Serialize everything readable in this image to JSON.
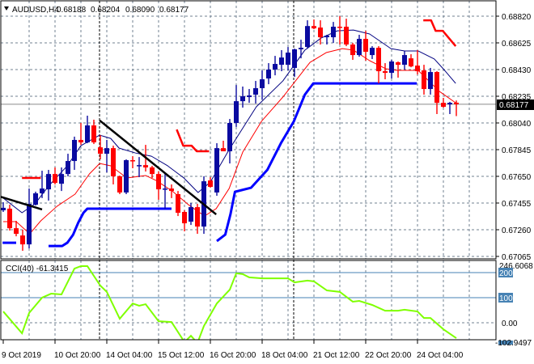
{
  "header": {
    "symbol": "AUDUSD,H4",
    "open": "0.68188",
    "high": "0.68204",
    "low": "0.68090",
    "close": "0.68177",
    "menu_icon": "triangle-down-icon"
  },
  "colors": {
    "bull": "#0a0aa0",
    "bear": "#ff0000",
    "ma_fast": "#000080",
    "ma_slow": "#ff0000",
    "support_step": "#0000ff",
    "resistance_step": "#ff0000",
    "trendline": "#000000",
    "cci_line": "#7fff00",
    "cci_level": "#4682b4",
    "grid": "#708090"
  },
  "price_axis": {
    "labels": [
      "0.68820",
      "0.68625",
      "0.68430",
      "0.68235",
      "0.68040",
      "0.67845",
      "0.67650",
      "0.67455",
      "0.67260",
      "0.67065"
    ],
    "current_price": "0.68177"
  },
  "time_axis": {
    "labels": [
      "9 Oct 2019",
      "10 Oct 20:00",
      "14 Oct 04:00",
      "15 Oct 12:00",
      "16 Oct 20:00",
      "18 Oct 04:00",
      "21 Oct 12:00",
      "22 Oct 20:00",
      "24 Oct 04:00"
    ],
    "bars_per_label": 8
  },
  "cci_panel": {
    "title": "CCI(40) -61.3415",
    "max_label": "246.6068",
    "min_label": "-102.9497",
    "level_labels": [
      "200",
      "100"
    ],
    "zero_label": "0.00"
  },
  "chart_data": [
    {
      "type": "candlestick",
      "title": "AUDUSD,H4",
      "ylim": [
        0.67065,
        0.6882
      ],
      "ohlc": [
        [
          0.67402,
          0.67461,
          0.6739,
          0.6742
        ],
        [
          0.67414,
          0.67443,
          0.67254,
          0.67271
        ],
        [
          0.67271,
          0.67325,
          0.67212,
          0.6723
        ],
        [
          0.67218,
          0.6726,
          0.67106,
          0.67153
        ],
        [
          0.67153,
          0.67561,
          0.67124,
          0.67449
        ],
        [
          0.67443,
          0.67538,
          0.67437,
          0.67526
        ],
        [
          0.67526,
          0.67691,
          0.67491,
          0.67561
        ],
        [
          0.67555,
          0.67697,
          0.67473,
          0.67667
        ],
        [
          0.67667,
          0.67715,
          0.67591,
          0.67602
        ],
        [
          0.67596,
          0.67715,
          0.67543,
          0.67667
        ],
        [
          0.67667,
          0.67815,
          0.6765,
          0.67762
        ],
        [
          0.67762,
          0.6794,
          0.67697,
          0.67916
        ],
        [
          0.67916,
          0.6804,
          0.6788,
          0.67898
        ],
        [
          0.67898,
          0.68093,
          0.67892,
          0.68022
        ],
        [
          0.68022,
          0.68064,
          0.67886,
          0.67898
        ],
        [
          0.67862,
          0.67951,
          0.67774,
          0.67815
        ],
        [
          0.67815,
          0.67916,
          0.67679,
          0.67856
        ],
        [
          0.67856,
          0.67874,
          0.67591,
          0.6765
        ],
        [
          0.6765,
          0.67656,
          0.6752,
          0.67532
        ],
        [
          0.67532,
          0.67774,
          0.6752,
          0.67768
        ],
        [
          0.67768,
          0.67797,
          0.67709,
          0.67762
        ],
        [
          0.67727,
          0.67791,
          0.67644,
          0.67732
        ],
        [
          0.67732,
          0.6788,
          0.67685,
          0.67715
        ],
        [
          0.67715,
          0.67727,
          0.67638,
          0.67667
        ],
        [
          0.67667,
          0.67685,
          0.67479,
          0.67555
        ],
        [
          0.67555,
          0.67667,
          0.67414,
          0.67561
        ],
        [
          0.67561,
          0.67591,
          0.67491,
          0.67543
        ],
        [
          0.6752,
          0.67543,
          0.6736,
          0.67384
        ],
        [
          0.6739,
          0.67402,
          0.67248,
          0.67307
        ],
        [
          0.67319,
          0.67455,
          0.67295,
          0.67425
        ],
        [
          0.67425,
          0.67449,
          0.6723,
          0.67283
        ],
        [
          0.67283,
          0.6765,
          0.6723,
          0.67614
        ],
        [
          0.6762,
          0.67644,
          0.67567,
          0.67573
        ],
        [
          0.67532,
          0.67892,
          0.67508,
          0.67856
        ],
        [
          0.67856,
          0.6791,
          0.67833,
          0.67833
        ],
        [
          0.67833,
          0.68069,
          0.67744,
          0.6804
        ],
        [
          0.6804,
          0.68317,
          0.68011,
          0.68199
        ],
        [
          0.68199,
          0.68306,
          0.68152,
          0.68235
        ],
        [
          0.68229,
          0.68288,
          0.68187,
          0.68241
        ],
        [
          0.68247,
          0.68347,
          0.68182,
          0.68294
        ],
        [
          0.68294,
          0.68424,
          0.68211,
          0.68359
        ],
        [
          0.68365,
          0.68477,
          0.68323,
          0.6843
        ],
        [
          0.6843,
          0.6853,
          0.68388,
          0.68471
        ],
        [
          0.68465,
          0.68572,
          0.68418,
          0.68518
        ],
        [
          0.68465,
          0.68595,
          0.68424,
          0.68554
        ],
        [
          0.68442,
          0.68583,
          0.68377,
          0.68578
        ],
        [
          0.68578,
          0.68648,
          0.68512,
          0.68589
        ],
        [
          0.68595,
          0.6879,
          0.68583,
          0.68748
        ],
        [
          0.68748,
          0.68796,
          0.68725,
          0.68731
        ],
        [
          0.68737,
          0.6879,
          0.68613,
          0.68666
        ],
        [
          0.68666,
          0.68684,
          0.68613,
          0.68678
        ],
        [
          0.68666,
          0.68778,
          0.68625,
          0.68743
        ],
        [
          0.68743,
          0.6882,
          0.68613,
          0.68737
        ],
        [
          0.68743,
          0.68802,
          0.68601,
          0.68613
        ],
        [
          0.68613,
          0.68625,
          0.68501,
          0.68536
        ],
        [
          0.68536,
          0.68684,
          0.68524,
          0.68654
        ],
        [
          0.68654,
          0.68713,
          0.68495,
          0.6856
        ],
        [
          0.68536,
          0.68601,
          0.68507,
          0.68589
        ],
        [
          0.68589,
          0.68601,
          0.68329,
          0.68418
        ],
        [
          0.68418,
          0.68477,
          0.68359,
          0.68406
        ],
        [
          0.68406,
          0.68501,
          0.68365,
          0.68489
        ],
        [
          0.68483,
          0.68489,
          0.68371,
          0.68465
        ],
        [
          0.68465,
          0.68566,
          0.6843,
          0.68536
        ],
        [
          0.68512,
          0.68542,
          0.68447,
          0.68453
        ],
        [
          0.68459,
          0.68572,
          0.68394,
          0.68418
        ],
        [
          0.68424,
          0.68465,
          0.68247,
          0.68288
        ],
        [
          0.68288,
          0.68442,
          0.68247,
          0.68412
        ],
        [
          0.68412,
          0.68418,
          0.68105,
          0.68187
        ],
        [
          0.68187,
          0.68223,
          0.68152,
          0.68158
        ],
        [
          0.68176,
          0.68194,
          0.68105,
          0.68187
        ],
        [
          0.68188,
          0.68204,
          0.6809,
          0.68177
        ]
      ],
      "overlays": {
        "ma_fast": [
          [
            0,
            0.67491
          ],
          [
            2.9,
            0.67384
          ],
          [
            4.9,
            0.67449
          ],
          [
            7,
            0.67579
          ],
          [
            9.9,
            0.67727
          ],
          [
            12,
            0.67874
          ],
          [
            14.9,
            0.67951
          ],
          [
            16.6,
            0.67927
          ],
          [
            17.9,
            0.67856
          ],
          [
            20.4,
            0.67821
          ],
          [
            22.9,
            0.67797
          ],
          [
            25.4,
            0.67727
          ],
          [
            27.9,
            0.67638
          ],
          [
            30.1,
            0.67532
          ],
          [
            32,
            0.67608
          ],
          [
            34.9,
            0.67845
          ],
          [
            39.1,
            0.68158
          ],
          [
            43.2,
            0.68347
          ],
          [
            46.6,
            0.68572
          ],
          [
            49.1,
            0.6866
          ],
          [
            51.6,
            0.68713
          ],
          [
            54.1,
            0.68719
          ],
          [
            56.6,
            0.6869
          ],
          [
            59.9,
            0.68583
          ],
          [
            62,
            0.68566
          ],
          [
            64.1,
            0.68566
          ],
          [
            66.6,
            0.68507
          ],
          [
            68.2,
            0.68424
          ],
          [
            69.9,
            0.68329
          ]
        ],
        "ma_slow": [
          [
            0,
            0.67319
          ],
          [
            2,
            0.67319
          ],
          [
            4.1,
            0.6723
          ],
          [
            5.8,
            0.67325
          ],
          [
            8.3,
            0.67431
          ],
          [
            11.1,
            0.6752
          ],
          [
            13.3,
            0.67667
          ],
          [
            14.9,
            0.67744
          ],
          [
            16.6,
            0.67727
          ],
          [
            19.1,
            0.67638
          ],
          [
            22,
            0.67656
          ],
          [
            23.6,
            0.6762
          ],
          [
            26.1,
            0.67543
          ],
          [
            28.6,
            0.67443
          ],
          [
            31.1,
            0.6736
          ],
          [
            32.9,
            0.67414
          ],
          [
            34.9,
            0.67561
          ],
          [
            37,
            0.67827
          ],
          [
            39.9,
            0.68052
          ],
          [
            43.2,
            0.68229
          ],
          [
            47.4,
            0.68483
          ],
          [
            49.9,
            0.68554
          ],
          [
            52.4,
            0.68583
          ],
          [
            54.1,
            0.68572
          ],
          [
            56.6,
            0.68495
          ],
          [
            59.1,
            0.68436
          ],
          [
            60.8,
            0.68424
          ],
          [
            64.1,
            0.68424
          ],
          [
            67.4,
            0.6827
          ],
          [
            69.9,
            0.68187
          ]
        ],
        "support_step": [
          [
            [
              -0.1,
              0.67165
            ],
            [
              2,
              0.67165
            ]
          ],
          [
            [
              7,
              0.67141
            ],
            [
              9.1,
              0.67141
            ],
            [
              9.9,
              0.67165
            ],
            [
              10.8,
              0.67224
            ],
            [
              11.6,
              0.67313
            ],
            [
              12.4,
              0.67384
            ],
            [
              13,
              0.67414
            ],
            [
              26,
              0.67414
            ]
          ],
          [
            [
              33,
              0.67177
            ],
            [
              34.3,
              0.67224
            ],
            [
              35.1,
              0.67372
            ],
            [
              35.8,
              0.67537
            ],
            [
              38.3,
              0.67567
            ],
            [
              40.8,
              0.67697
            ],
            [
              42.9,
              0.67892
            ],
            [
              44.9,
              0.68052
            ],
            [
              46.6,
              0.68247
            ],
            [
              47.9,
              0.68329
            ],
            [
              63.9,
              0.68329
            ]
          ]
        ],
        "resistance_step": [
          [
            [
              2.9,
              0.67638
            ],
            [
              5.8,
              0.67638
            ]
          ],
          [
            [
              26.8,
              0.67992
            ],
            [
              27.8,
              0.67874
            ],
            [
              29.1,
              0.67874
            ],
            [
              29.9,
              0.67833
            ],
            [
              31.8,
              0.67833
            ]
          ],
          [
            [
              64.9,
              0.6879
            ],
            [
              66.1,
              0.6879
            ],
            [
              66.8,
              0.68713
            ],
            [
              67.9,
              0.68713
            ],
            [
              69.9,
              0.68601
            ]
          ]
        ],
        "trendlines": [
          [
            [
              -0.5,
              0.67502
            ],
            [
              6,
              0.67408
            ]
          ],
          [
            [
              14.9,
              0.68058
            ],
            [
              32.9,
              0.67372
            ]
          ]
        ]
      }
    },
    {
      "type": "line",
      "title": "CCI(40)",
      "ylim": [
        -102.9497,
        246.6068
      ],
      "levels": [
        200,
        100,
        0
      ],
      "points": [
        [
          0,
          45
        ],
        [
          1.4,
          3
        ],
        [
          2.9,
          -42
        ],
        [
          4,
          39
        ],
        [
          6,
          100
        ],
        [
          7.4,
          116
        ],
        [
          9,
          113
        ],
        [
          11,
          216
        ],
        [
          12,
          226
        ],
        [
          13,
          226
        ],
        [
          15,
          148
        ],
        [
          16,
          123
        ],
        [
          18,
          16
        ],
        [
          20,
          77
        ],
        [
          21,
          68
        ],
        [
          22,
          74
        ],
        [
          24,
          6
        ],
        [
          26,
          3
        ],
        [
          28,
          -77
        ],
        [
          29,
          -52
        ],
        [
          30,
          -81
        ],
        [
          31,
          -13
        ],
        [
          33,
          77
        ],
        [
          35,
          132
        ],
        [
          36,
          197
        ],
        [
          37,
          194
        ],
        [
          38,
          181
        ],
        [
          40,
          177
        ],
        [
          44,
          177
        ],
        [
          45,
          161
        ],
        [
          47,
          168
        ],
        [
          48,
          165
        ],
        [
          50,
          129
        ],
        [
          52,
          123
        ],
        [
          54,
          84
        ],
        [
          55,
          87
        ],
        [
          57,
          71
        ],
        [
          59,
          48
        ],
        [
          61,
          48
        ],
        [
          62,
          52
        ],
        [
          64,
          45
        ],
        [
          65,
          19
        ],
        [
          66,
          19
        ],
        [
          68,
          -26
        ],
        [
          70,
          -61.3415
        ]
      ]
    }
  ]
}
